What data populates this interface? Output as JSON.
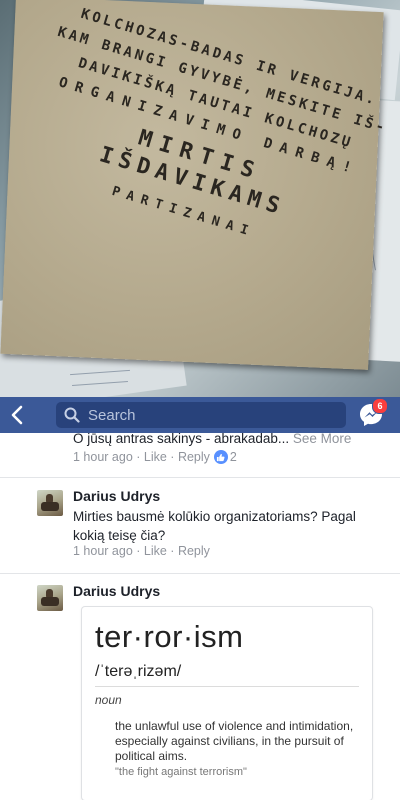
{
  "photo": {
    "slogan_lines": [
      "KOLCHOZAS-BADAS IR VERGIJA.",
      "KAM BRANGI GYVYBĖ, MESKITE IŠ-",
      "DAVIKIŠKĄ TAUTAI KOLCHOZŲ",
      "ORGANIZAVIMO DARBĄ!",
      "MIRTIS",
      "IŠDAVIKAMS",
      "PARTIZANAI"
    ]
  },
  "navbar": {
    "back_icon": "chevron-left-icon",
    "search_placeholder": "Search",
    "search_icon": "search-icon",
    "messenger_icon": "messenger-icon",
    "messenger_badge": "6",
    "bar_color": "#3b5998"
  },
  "comments": [
    {
      "text_partial": "O jūsų antras sakinys - abrakadab...",
      "see_more": "See More",
      "time": "1 hour ago",
      "like": "Like",
      "reply": "Reply",
      "reactions": "2"
    },
    {
      "author": "Darius Udrys",
      "text": "Mirties bausmė kolūkio organizatoriams? Pagal kokią teisę čia?",
      "time": "1 hour ago",
      "like": "Like",
      "reply": "Reply"
    },
    {
      "author": "Darius Udrys",
      "dictionary": {
        "word": "ter·ror·ism",
        "pronunciation": "/ˈterəˌrizəm/",
        "part_of_speech": "noun",
        "definition": "the unlawful use of violence and intimidation, especially against civilians, in the pursuit of political aims.",
        "example": "\"the fight against terrorism\""
      }
    }
  ]
}
